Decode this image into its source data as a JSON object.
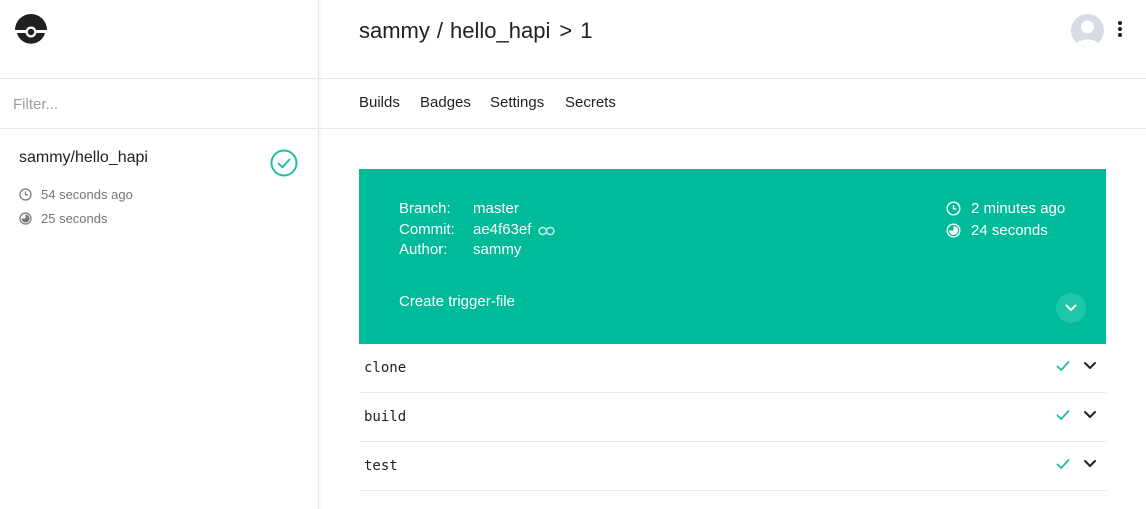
{
  "sidebar": {
    "filter_placeholder": "Filter...",
    "repos": [
      {
        "name": "sammy/hello_hapi",
        "status": "success",
        "last_build": "54 seconds ago",
        "duration": "25 seconds"
      }
    ]
  },
  "header": {
    "owner": "sammy",
    "separator": "/",
    "repo": "hello_hapi",
    "chevron": ">",
    "build_number": "1"
  },
  "tabs": [
    "Builds",
    "Badges",
    "Settings",
    "Secrets"
  ],
  "build": {
    "branch_label": "Branch:",
    "branch": "master",
    "commit_label": "Commit:",
    "commit": "ae4f63ef",
    "author_label": "Author:",
    "author": "sammy",
    "started": "2 minutes ago",
    "duration": "24 seconds",
    "message": "Create trigger-file",
    "status_color": "#00bb9a"
  },
  "steps": [
    {
      "name": "clone",
      "status": "success"
    },
    {
      "name": "build",
      "status": "success"
    },
    {
      "name": "test",
      "status": "success"
    }
  ],
  "colors": {
    "accent": "#00bb9a",
    "success": "#1dbf9f",
    "border": "#e8e8e8"
  }
}
